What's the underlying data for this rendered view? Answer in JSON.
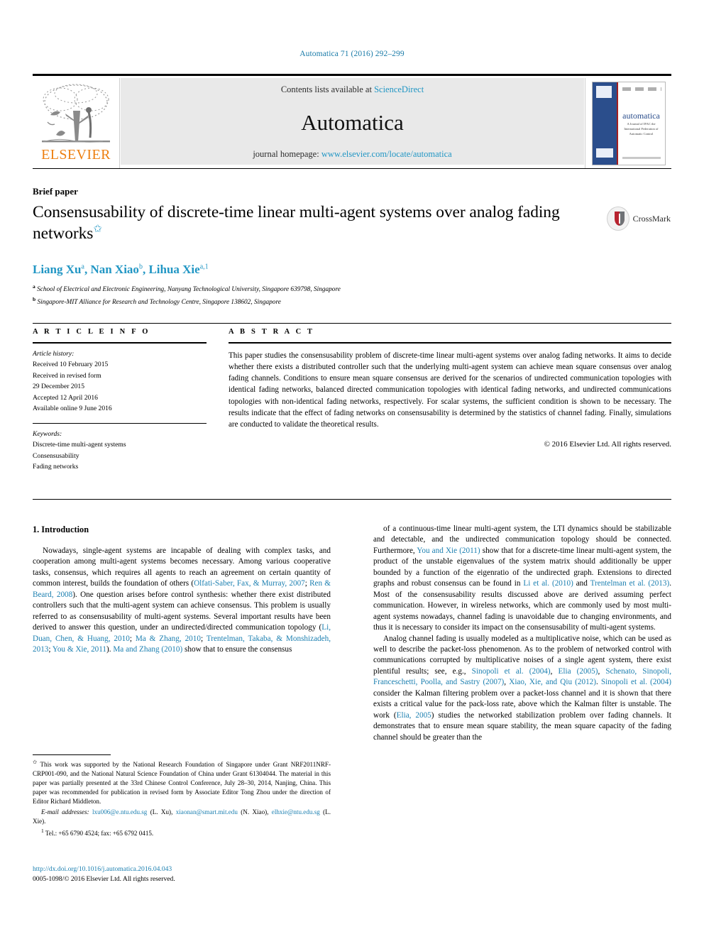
{
  "running_head": "Automatica 71 (2016) 292–299",
  "masthead": {
    "contents_prefix": "Contents lists available at ",
    "contents_link": "ScienceDirect",
    "journal_name": "Automatica",
    "homepage_prefix": "journal homepage: ",
    "homepage_url": "www.elsevier.com/locate/automatica",
    "publisher_wordmark": "ELSEVIER",
    "cover": {
      "title": "automatica",
      "subtitle": "A Journal of IFAC the International Federation of Automatic Control",
      "badge_left_top": "IFAC",
      "badge_left_bottom": "IFAC"
    }
  },
  "article": {
    "type_label": "Brief paper",
    "title": "Consensusability of discrete-time linear multi-agent systems over analog fading networks",
    "title_footnote_marker": "✩",
    "authors": "Liang Xu a, Nan Xiao b, Lihua Xie a,1",
    "authors_parts": [
      {
        "name": "Liang Xu",
        "sup": "a"
      },
      {
        "name": "Nan Xiao",
        "sup": "b"
      },
      {
        "name": "Lihua Xie",
        "sup": "a,1"
      }
    ],
    "affiliations": [
      {
        "marker": "a",
        "text": "School of Electrical and Electronic Engineering, Nanyang Technological University, Singapore 639798, Singapore"
      },
      {
        "marker": "b",
        "text": "Singapore-MIT Alliance for Research and Technology Centre, Singapore 138602, Singapore"
      }
    ],
    "crossmark_label": "CrossMark"
  },
  "info": {
    "heading": "A R T I C L E    I N F O",
    "history_label": "Article history:",
    "history": [
      "Received 10 February 2015",
      "Received in revised form",
      "29 December 2015",
      "Accepted 12 April 2016",
      "Available online 9 June 2016"
    ],
    "keywords_label": "Keywords:",
    "keywords": [
      "Discrete-time multi-agent systems",
      "Consensusability",
      "Fading networks"
    ]
  },
  "abstract": {
    "heading": "A B S T R A C T",
    "text": "This paper studies the consensusability problem of discrete-time linear multi-agent systems over analog fading networks. It aims to decide whether there exists a distributed controller such that the underlying multi-agent system can achieve mean square consensus over analog fading channels. Conditions to ensure mean square consensus are derived for the scenarios of undirected communication topologies with identical fading networks, balanced directed communication topologies with identical fading networks, and undirected communications topologies with non-identical fading networks, respectively. For scalar systems, the sufficient condition is shown to be necessary. The results indicate that the effect of fading networks on consensusability is determined by the statistics of channel fading. Finally, simulations are conducted to validate the theoretical results.",
    "copyright": "© 2016 Elsevier Ltd. All rights reserved."
  },
  "body": {
    "section_heading": "1. Introduction",
    "left_paragraph_1": "Nowadays, single-agent systems are incapable of dealing with complex tasks, and cooperation among multi-agent systems becomes necessary. Among various cooperative tasks, consensus, which requires all agents to reach an agreement on certain quantity of common interest, builds the foundation of others (Olfati-Saber, Fax, & Murray, 2007; Ren & Beard, 2008). One question arises before control synthesis: whether there exist distributed controllers such that the multi-agent system can achieve consensus. This problem is usually referred to as consensusability of multi-agent systems. Several important results have been derived to answer this question, under an undirected/directed communication topology (Li, Duan, Chen, & Huang, 2010; Ma & Zhang, 2010; Trentelman, Takaba, & Monshizadeh, 2013; You & Xie, 2011). Ma and Zhang (2010) show that to ensure the consensus",
    "right_paragraph_1": "of a continuous-time linear multi-agent system, the LTI dynamics should be stabilizable and detectable, and the undirected communication topology should be connected. Furthermore, You and Xie (2011) show that for a discrete-time linear multi-agent system, the product of the unstable eigenvalues of the system matrix should additionally be upper bounded by a function of the eigenratio of the undirected graph. Extensions to directed graphs and robust consensus can be found in Li et al. (2010) and Trentelman et al. (2013). Most of the consensusability results discussed above are derived assuming perfect communication. However, in wireless networks, which are commonly used by most multi-agent systems nowadays, channel fading is unavoidable due to changing environments, and thus it is necessary to consider its impact on the consensusability of multi-agent systems.",
    "right_paragraph_2": "Analog channel fading is usually modeled as a multiplicative noise, which can be used as well to describe the packet-loss phenomenon. As to the problem of networked control with communications corrupted by multiplicative noises of a single agent system, there exist plentiful results; see, e.g., Sinopoli et al. (2004), Elia (2005), Schenato, Sinopoli, Franceschetti, Poolla, and Sastry (2007), Xiao, Xie, and Qiu (2012). Sinopoli et al. (2004) consider the Kalman filtering problem over a packet-loss channel and it is shown that there exists a critical value for the pack-loss rate, above which the Kalman filter is unstable. The work (Elia, 2005) studies the networked stabilization problem over fading channels. It demonstrates that to ensure mean square stability, the mean square capacity of the fading channel should be greater than the"
  },
  "footnotes": {
    "star_marker": "✩",
    "star_text": "This work was supported by the National Research Foundation of Singapore under Grant NRF2011NRF-CRP001-090, and the National Natural Science Foundation of China under Grant 61304044. The material in this paper was partially presented at the 33rd Chinese Control Conference, July 28–30, 2014, Nanjing, China. This paper was recommended for publication in revised form by Associate Editor Tong Zhou under the direction of Editor Richard Middleton.",
    "email_label": "E-mail addresses:",
    "emails": [
      {
        "address": "lxu006@e.ntu.edu.sg",
        "owner": "(L. Xu)"
      },
      {
        "address": "xiaonan@smart.mit.edu",
        "owner": "(N. Xiao)"
      },
      {
        "address": "elhxie@ntu.edu.sg",
        "owner": "(L. Xie)"
      }
    ],
    "tel_marker": "1",
    "tel_text": "Tel.: +65 6790 4524; fax: +65 6792 0415."
  },
  "doi": {
    "url": "http://dx.doi.org/10.1016/j.automatica.2016.04.043",
    "issn_line": "0005-1098/© 2016 Elsevier Ltd. All rights reserved."
  },
  "colors": {
    "link_blue": "#1b7fb0",
    "elsevier_orange": "#ED7F10",
    "cover_blue": "#2b4e8c",
    "masthead_gray": "#e9e9e9"
  }
}
